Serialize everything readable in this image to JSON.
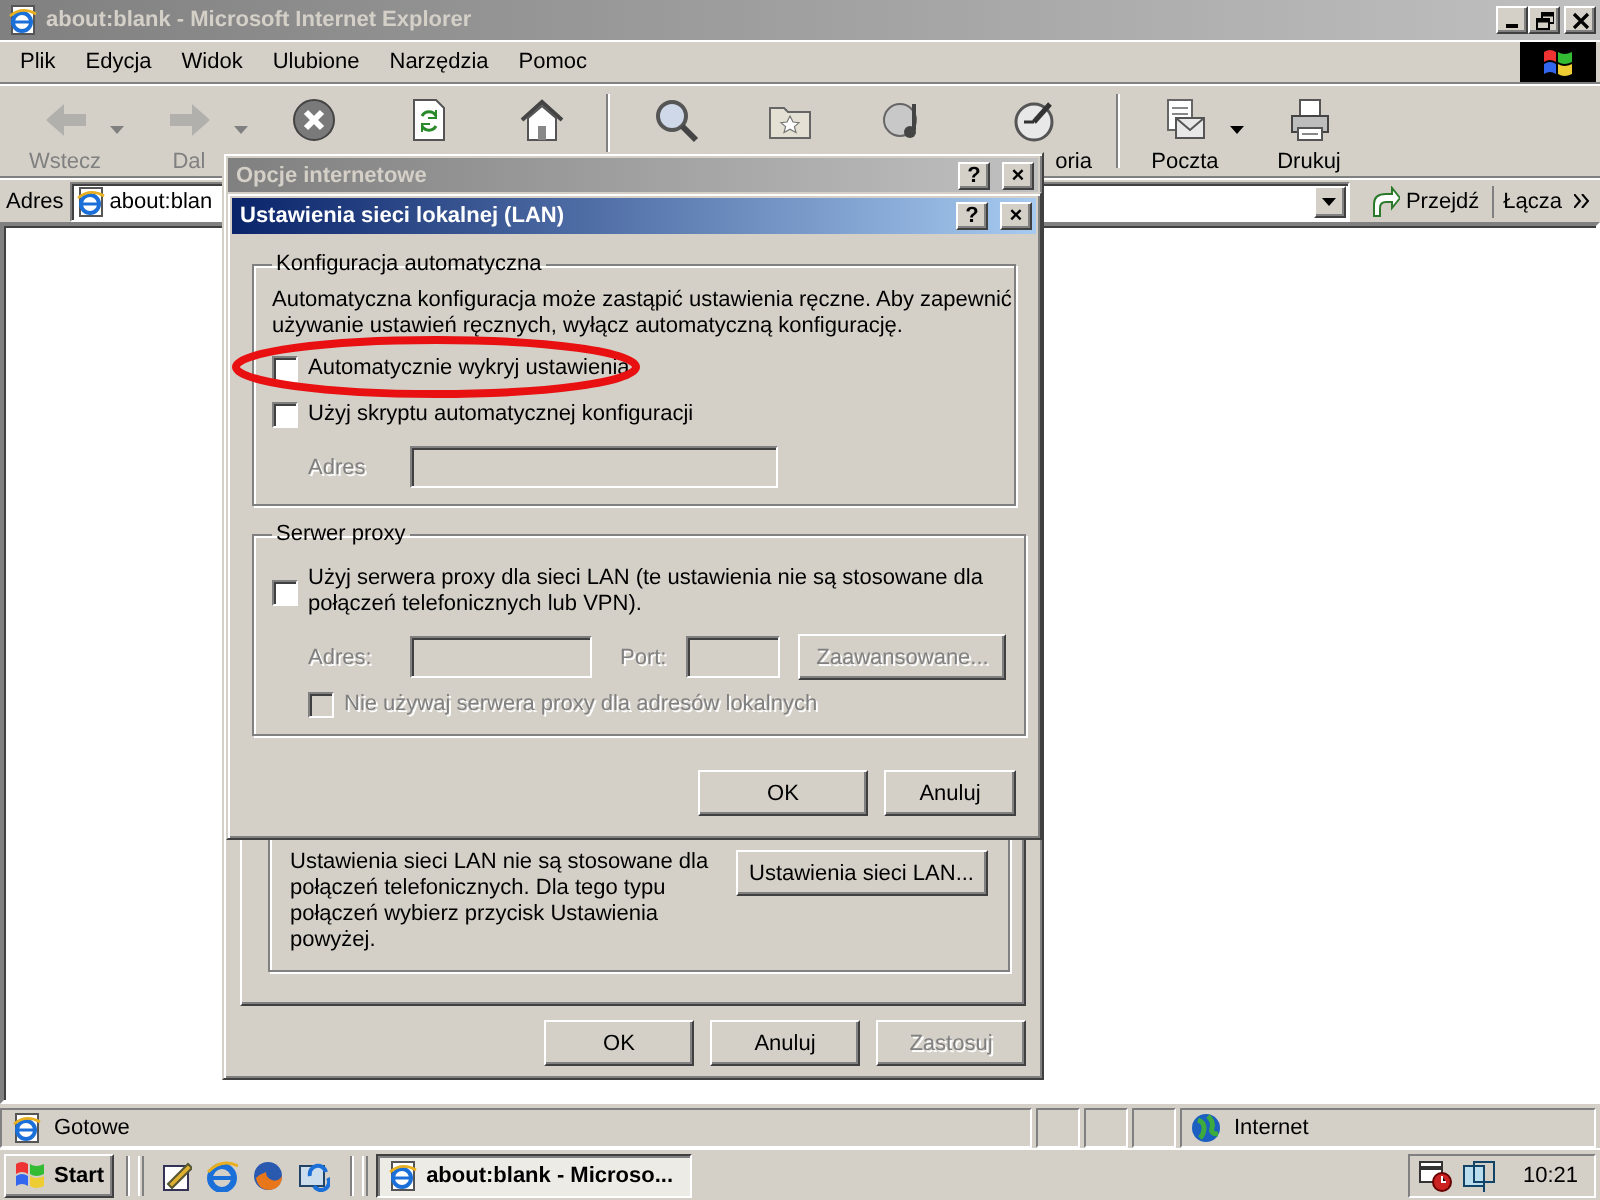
{
  "window": {
    "title": "about:blank - Microsoft Internet Explorer",
    "active": false
  },
  "menu": [
    {
      "label": "Plik"
    },
    {
      "label": "Edycja"
    },
    {
      "label": "Widok"
    },
    {
      "label": "Ulubione"
    },
    {
      "label": "Narzędzia"
    },
    {
      "label": "Pomoc"
    }
  ],
  "toolbar": {
    "groups": [
      {
        "buttons": [
          {
            "kind": "back",
            "label": "Wstecz",
            "disabled": true,
            "dropdown": true
          },
          {
            "kind": "forward",
            "label": "Dal",
            "disabled": true,
            "dropdown": true
          },
          {
            "kind": "stop",
            "disabled": false,
            "dropdown": false
          },
          {
            "kind": "refresh",
            "disabled": false,
            "dropdown": false
          },
          {
            "kind": "home",
            "disabled": false,
            "dropdown": false
          }
        ]
      },
      {
        "buttons": [
          {
            "kind": "search",
            "disabled": false,
            "dropdown": false
          },
          {
            "kind": "favorites",
            "disabled": false,
            "dropdown": false
          },
          {
            "kind": "media",
            "disabled": false,
            "dropdown": false
          },
          {
            "kind": "history",
            "label": "oria",
            "disabled": false,
            "dropdown": false
          }
        ]
      },
      {
        "buttons": [
          {
            "kind": "mail",
            "label": "Poczta",
            "disabled": false,
            "dropdown": true
          },
          {
            "kind": "print",
            "label": "Drukuj",
            "disabled": false,
            "dropdown": false
          }
        ]
      }
    ]
  },
  "address_bar": {
    "label": "Adres",
    "value": "about:blan",
    "go_button": "Przejdź",
    "links": "Łącza"
  },
  "status_bar": {
    "text": "Gotowe",
    "zone": "Internet"
  },
  "taskbar": {
    "start": "Start",
    "quick_launch": [
      {
        "kind": "notepad"
      },
      {
        "kind": "browser"
      },
      {
        "kind": "fox"
      },
      {
        "kind": "sync"
      }
    ],
    "tasks": [
      {
        "label": "about:blank - Microso...",
        "selected": true
      }
    ],
    "clock": "10:21"
  },
  "options_dialog": {
    "title": "Opcje internetowe",
    "active": false,
    "controls": [
      {
        "kind": "help",
        "label": "?"
      },
      {
        "kind": "close",
        "label": "×"
      }
    ],
    "lan_text": "Ustawienia sieci LAN nie są stosowane dla połączeń telefonicznych. Dla tego typu połączeń wybierz przycisk Ustawienia powyżej.",
    "lan_button": "Ustawienia sieci LAN...",
    "buttons": [
      {
        "label": "OK",
        "disabled": false
      },
      {
        "label": "Anuluj",
        "disabled": false
      },
      {
        "label": "Zastosuj",
        "disabled": true
      }
    ]
  },
  "lan_dialog": {
    "title": "Ustawienia sieci lokalnej (LAN)",
    "active": true,
    "controls": [
      {
        "kind": "help",
        "label": "?"
      },
      {
        "kind": "close",
        "label": "×"
      }
    ],
    "auto_config": {
      "legend": "Konfiguracja automatyczna",
      "description": "Automatyczna konfiguracja może zastąpić ustawienia ręczne. Aby zapewnić używanie ustawień ręcznych, wyłącz automatyczną konfigurację.",
      "options": [
        {
          "label": "Automatycznie wykryj ustawienia",
          "checked": false,
          "disabled": false,
          "circled": true
        },
        {
          "label": "Użyj skryptu automatycznej konfiguracji",
          "checked": false,
          "disabled": false,
          "circled": false
        }
      ],
      "address": {
        "label": "Adres",
        "disabled": true
      }
    },
    "proxy": {
      "legend": "Serwer proxy",
      "option": {
        "label": "Użyj serwera proxy dla sieci LAN (te ustawienia nie są stosowane dla połączeń telefonicznych lub VPN).",
        "checked": false,
        "disabled": false
      },
      "address": {
        "label": "Adres:",
        "disabled": true
      },
      "port": {
        "label": "Port:",
        "disabled": true
      },
      "advanced_button": {
        "label": "Zaawansowane...",
        "disabled": true
      },
      "bypass": {
        "label": "Nie używaj serwera proxy dla adresów lokalnych",
        "checked": false,
        "disabled": true
      }
    },
    "buttons": [
      {
        "label": "OK",
        "disabled": false
      },
      {
        "label": "Anuluj",
        "disabled": false
      }
    ]
  }
}
